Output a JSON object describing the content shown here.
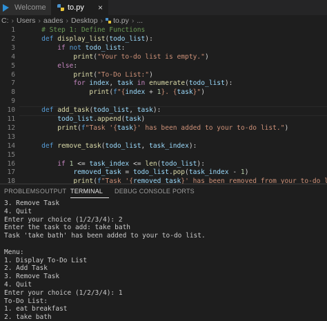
{
  "tabs": [
    {
      "label": "Welcome"
    },
    {
      "label": "to.py",
      "close": "×"
    }
  ],
  "breadcrumb": [
    "C:",
    "Users",
    "aades",
    "Desktop",
    "to.py",
    "..."
  ],
  "code_lines": [
    {
      "n": "1",
      "tokens": [
        [
          "    ",
          ""
        ],
        [
          "# Step 1: Define Functions",
          "c"
        ]
      ]
    },
    {
      "n": "2",
      "tokens": [
        [
          "    ",
          ""
        ],
        [
          "def",
          "kw"
        ],
        [
          " ",
          ""
        ],
        [
          "display_list",
          "fn"
        ],
        [
          "(",
          ""
        ],
        [
          "todo_list",
          "v"
        ],
        [
          "):",
          ""
        ]
      ]
    },
    {
      "n": "3",
      "tokens": [
        [
          "        ",
          ""
        ],
        [
          "if",
          "k"
        ],
        [
          " ",
          ""
        ],
        [
          "not",
          "kw"
        ],
        [
          " ",
          ""
        ],
        [
          "todo_list",
          "v"
        ],
        [
          ":",
          ""
        ]
      ]
    },
    {
      "n": "4",
      "tokens": [
        [
          "            ",
          ""
        ],
        [
          "print",
          "fn"
        ],
        [
          "(",
          ""
        ],
        [
          "\"Your to-do list is empty.\"",
          "s"
        ],
        [
          ")",
          ""
        ]
      ]
    },
    {
      "n": "5",
      "tokens": [
        [
          "        ",
          ""
        ],
        [
          "else",
          "k"
        ],
        [
          ":",
          ""
        ]
      ]
    },
    {
      "n": "6",
      "tokens": [
        [
          "            ",
          ""
        ],
        [
          "print",
          "fn"
        ],
        [
          "(",
          ""
        ],
        [
          "\"To-Do List:\"",
          "s"
        ],
        [
          ")",
          ""
        ]
      ]
    },
    {
      "n": "7",
      "tokens": [
        [
          "            ",
          ""
        ],
        [
          "for",
          "k"
        ],
        [
          " ",
          ""
        ],
        [
          "index",
          "v"
        ],
        [
          ", ",
          ""
        ],
        [
          "task",
          "v"
        ],
        [
          " ",
          ""
        ],
        [
          "in",
          "k"
        ],
        [
          " ",
          ""
        ],
        [
          "enumerate",
          "fn"
        ],
        [
          "(",
          ""
        ],
        [
          "todo_list",
          "v"
        ],
        [
          "):",
          ""
        ]
      ]
    },
    {
      "n": "8",
      "tokens": [
        [
          "                ",
          ""
        ],
        [
          "print",
          "fn"
        ],
        [
          "(",
          ""
        ],
        [
          "f",
          "kw"
        ],
        [
          "\"{",
          "s"
        ],
        [
          "index",
          "v"
        ],
        [
          " + ",
          ""
        ],
        [
          "1",
          "n"
        ],
        [
          "}. {",
          "s"
        ],
        [
          "task",
          "v"
        ],
        [
          "}\"",
          "s"
        ],
        [
          ")",
          ""
        ]
      ]
    },
    {
      "n": "9",
      "tokens": []
    },
    {
      "n": "10",
      "tokens": [
        [
          "    ",
          ""
        ],
        [
          "def",
          "kw"
        ],
        [
          " ",
          ""
        ],
        [
          "add_task",
          "fn"
        ],
        [
          "(",
          ""
        ],
        [
          "todo_list",
          "v"
        ],
        [
          ", ",
          ""
        ],
        [
          "task",
          "v"
        ],
        [
          "):",
          ""
        ]
      ],
      "current": true
    },
    {
      "n": "11",
      "tokens": [
        [
          "        ",
          ""
        ],
        [
          "todo_list",
          "v"
        ],
        [
          ".",
          ""
        ],
        [
          "append",
          "fn"
        ],
        [
          "(",
          ""
        ],
        [
          "task",
          "v"
        ],
        [
          ")",
          ""
        ]
      ]
    },
    {
      "n": "12",
      "tokens": [
        [
          "        ",
          ""
        ],
        [
          "print",
          "fn"
        ],
        [
          "(",
          ""
        ],
        [
          "f",
          "kw"
        ],
        [
          "\"Task '{",
          "s"
        ],
        [
          "task",
          "v"
        ],
        [
          "}' has been added to your to-do list.\"",
          "s"
        ],
        [
          ")",
          ""
        ]
      ]
    },
    {
      "n": "13",
      "tokens": []
    },
    {
      "n": "14",
      "tokens": [
        [
          "    ",
          ""
        ],
        [
          "def",
          "kw"
        ],
        [
          " ",
          ""
        ],
        [
          "remove_task",
          "fn"
        ],
        [
          "(",
          ""
        ],
        [
          "todo_list",
          "v"
        ],
        [
          ", ",
          ""
        ],
        [
          "task_index",
          "v"
        ],
        [
          "):",
          ""
        ]
      ]
    },
    {
      "n": "15",
      "tokens": []
    },
    {
      "n": "16",
      "tokens": [
        [
          "        ",
          ""
        ],
        [
          "if",
          "k"
        ],
        [
          " ",
          ""
        ],
        [
          "1",
          "n"
        ],
        [
          " <= ",
          ""
        ],
        [
          "task_index",
          "v"
        ],
        [
          " <= ",
          ""
        ],
        [
          "len",
          "fn"
        ],
        [
          "(",
          ""
        ],
        [
          "todo_list",
          "v"
        ],
        [
          "):",
          ""
        ]
      ]
    },
    {
      "n": "17",
      "tokens": [
        [
          "            ",
          ""
        ],
        [
          "removed_task",
          "v"
        ],
        [
          " = ",
          ""
        ],
        [
          "todo_list",
          "v"
        ],
        [
          ".",
          ""
        ],
        [
          "pop",
          "fn"
        ],
        [
          "(",
          ""
        ],
        [
          "task_index",
          "v"
        ],
        [
          " - ",
          ""
        ],
        [
          "1",
          "n"
        ],
        [
          ")",
          ""
        ]
      ]
    },
    {
      "n": "18",
      "tokens": [
        [
          "            ",
          ""
        ],
        [
          "print",
          "fn"
        ],
        [
          "(",
          ""
        ],
        [
          "f",
          "kw"
        ],
        [
          "\"Task '{",
          "s"
        ],
        [
          "removed_task",
          "v"
        ],
        [
          "}' has been removed from your to-do list.\"",
          "s"
        ],
        [
          ")",
          ""
        ]
      ]
    }
  ],
  "panel_tabs": [
    "PROBLEMS",
    "OUTPUT",
    "TERMINAL",
    "DEBUG CONSOLE",
    "PORTS"
  ],
  "active_panel_tab": "TERMINAL",
  "terminal_lines": [
    "3. Remove Task",
    "4. Quit",
    "Enter your choice (1/2/3/4): 2",
    "Enter the task to add: take bath",
    "Task 'take bath' has been added to your to-do list.",
    "",
    "Menu:",
    "1. Display To-Do List",
    "2. Add Task",
    "3. Remove Task",
    "4. Quit",
    "Enter your choice (1/2/3/4): 1",
    "To-Do List:",
    "1. eat breakfast",
    "2. take bath"
  ]
}
